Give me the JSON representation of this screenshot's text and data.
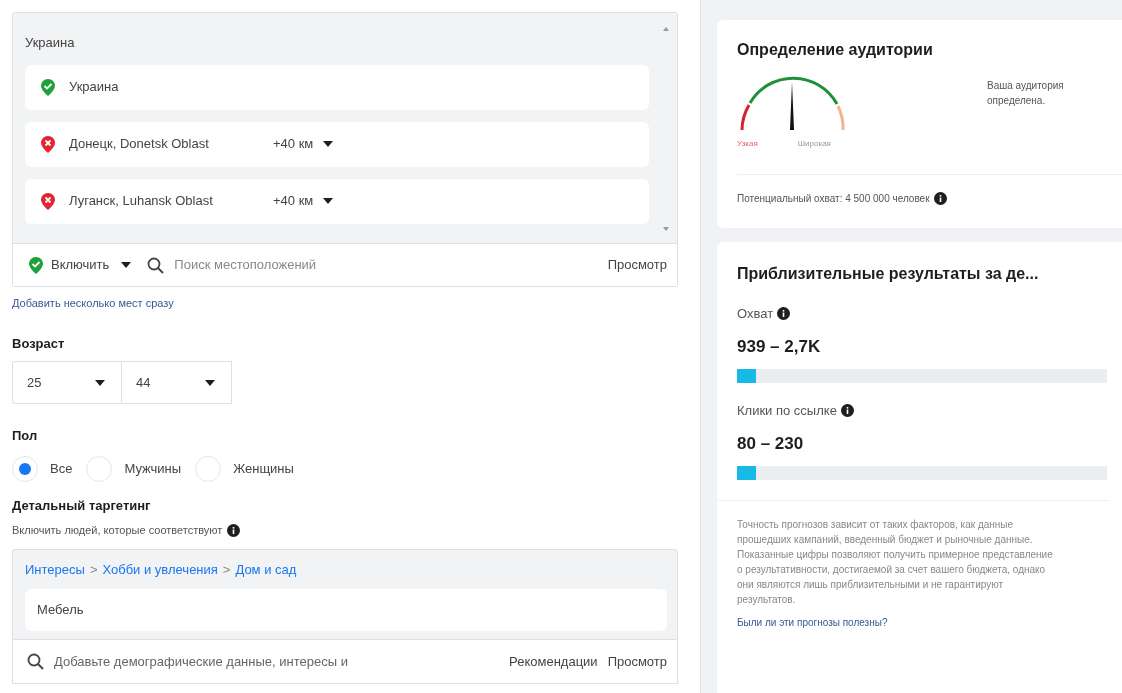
{
  "locations": {
    "group_title": "Украина",
    "items": [
      {
        "kind": "include",
        "name": "Украина"
      },
      {
        "kind": "exclude",
        "name": "Донецк, Donetsk Oblast",
        "radius": "+40 км"
      },
      {
        "kind": "exclude",
        "name": "Луганск, Luhansk Oblast",
        "radius": "+40 км"
      }
    ],
    "mode": "Включить",
    "search_placeholder": "Поиск местоположений",
    "browse": "Просмотр"
  },
  "add_multiple_link": "Добавить несколько мест сразу",
  "age": {
    "label": "Возраст",
    "from": "25",
    "to": "44"
  },
  "gender": {
    "label": "Пол",
    "options": [
      {
        "label": "Все",
        "selected": true
      },
      {
        "label": "Мужчины",
        "selected": false
      },
      {
        "label": "Женщины",
        "selected": false
      }
    ]
  },
  "detailed": {
    "label": "Детальный таргетинг",
    "subtitle": "Включить людей, которые соответствуют",
    "breadcrumb": [
      {
        "kind": "link",
        "text": "Интересы"
      },
      {
        "kind": "separator",
        "text": ">"
      },
      {
        "kind": "link",
        "text": "Хобби и увлечения"
      },
      {
        "kind": "separator",
        "text": ">"
      },
      {
        "kind": "link",
        "text": "Дом и сад"
      }
    ],
    "selected_item": "Мебель",
    "search_placeholder": "Добавьте демографические данные, интересы и",
    "suggestions": "Рекомендации",
    "browse": "Просмотр"
  },
  "audience": {
    "title": "Определение аудитории",
    "gauge_left": "Узкая",
    "gauge_right": "Широкая",
    "status": "Ваша аудитория определена.",
    "potential_reach": "Потенциальный охват: 4 500 000 человек"
  },
  "estimates": {
    "title": "Приблизительные результаты за де...",
    "metrics": [
      {
        "label": "Охват",
        "value": "939 – 2,7K",
        "level": 0.05
      },
      {
        "label": "Клики по ссылке",
        "value": "80 – 230",
        "level": 0.05
      }
    ],
    "note": "Точность прогнозов зависит от таких факторов, как данные прошедших кампаний, введенный бюджет и рыночные данные. Показанные цифры позволяют получить примерное представление о результативности, достигаемой за счет вашего бюджета, однако они являются лишь приблизительными и не гарантируют результатов.",
    "feedback_link": "Были ли эти прогнозы полезны?"
  }
}
